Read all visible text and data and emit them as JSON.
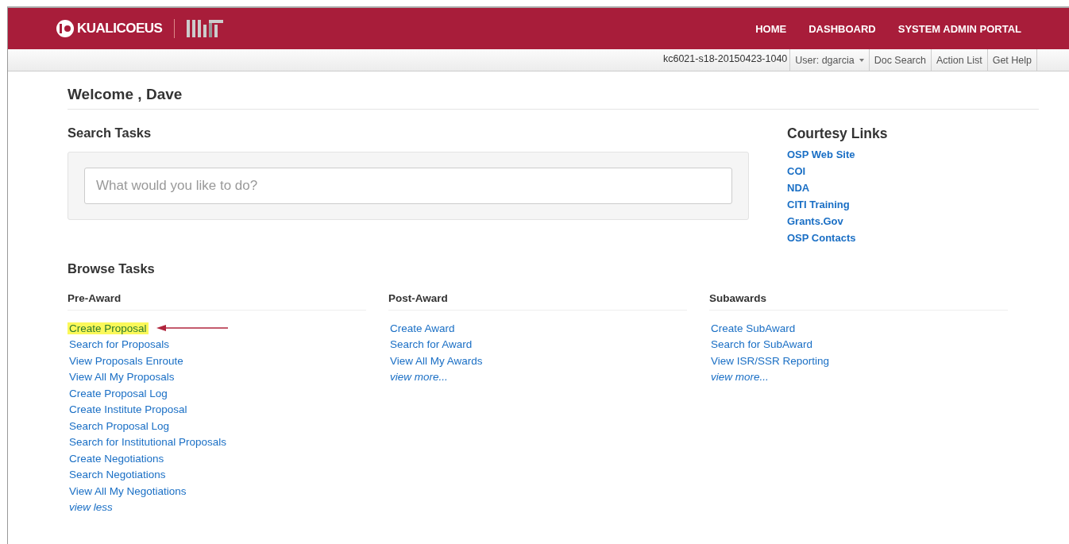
{
  "header": {
    "brand": "KUALICOEUS",
    "nav": [
      "HOME",
      "DASHBOARD",
      "SYSTEM ADMIN PORTAL"
    ]
  },
  "toolbar": {
    "environment": "kc6021-s18-20150423-1040",
    "buttons": [
      {
        "label": "User: dgarcia",
        "kind": "dropdown"
      },
      {
        "label": "Doc Search",
        "kind": "plain"
      },
      {
        "label": "Action List",
        "kind": "plain"
      },
      {
        "label": "Get Help",
        "kind": "plain"
      }
    ]
  },
  "welcome": "Welcome , Dave",
  "search_tasks": {
    "title": "Search Tasks",
    "placeholder": "What would you like to do?"
  },
  "courtesy_links": {
    "title": "Courtesy Links",
    "links": [
      "OSP Web Site",
      "COI",
      "NDA",
      "CITI Training",
      "Grants.Gov",
      "OSP Contacts"
    ]
  },
  "browse_tasks": {
    "title": "Browse Tasks",
    "columns": [
      {
        "title": "Pre-Award",
        "links": [
          {
            "label": "Create Proposal",
            "kind": "link",
            "highlighted": true
          },
          {
            "label": "Search for Proposals",
            "kind": "link",
            "highlighted": false
          },
          {
            "label": "View Proposals Enroute",
            "kind": "link",
            "highlighted": false
          },
          {
            "label": "View All My Proposals",
            "kind": "link",
            "highlighted": false
          },
          {
            "label": "Create Proposal Log",
            "kind": "link",
            "highlighted": false
          },
          {
            "label": "Create Institute Proposal",
            "kind": "link",
            "highlighted": false
          },
          {
            "label": "Search Proposal Log",
            "kind": "link",
            "highlighted": false
          },
          {
            "label": "Search for Institutional Proposals",
            "kind": "link",
            "highlighted": false
          },
          {
            "label": "Create Negotiations",
            "kind": "link",
            "highlighted": false
          },
          {
            "label": "Search Negotiations",
            "kind": "link",
            "highlighted": false
          },
          {
            "label": "View All My Negotiations",
            "kind": "link",
            "highlighted": false
          },
          {
            "label": "view less",
            "kind": "toggle",
            "highlighted": false
          }
        ]
      },
      {
        "title": "Post-Award",
        "links": [
          {
            "label": "Create Award",
            "kind": "link",
            "highlighted": false
          },
          {
            "label": "Search for Award",
            "kind": "link",
            "highlighted": false
          },
          {
            "label": "View All My Awards",
            "kind": "link",
            "highlighted": false
          },
          {
            "label": "view more...",
            "kind": "toggle",
            "highlighted": false
          }
        ]
      },
      {
        "title": "Subawards",
        "links": [
          {
            "label": "Create SubAward",
            "kind": "link",
            "highlighted": false
          },
          {
            "label": "Search for SubAward",
            "kind": "link",
            "highlighted": false
          },
          {
            "label": "View ISR/SSR Reporting",
            "kind": "link",
            "highlighted": false
          },
          {
            "label": "view more...",
            "kind": "toggle",
            "highlighted": false
          }
        ]
      }
    ]
  }
}
